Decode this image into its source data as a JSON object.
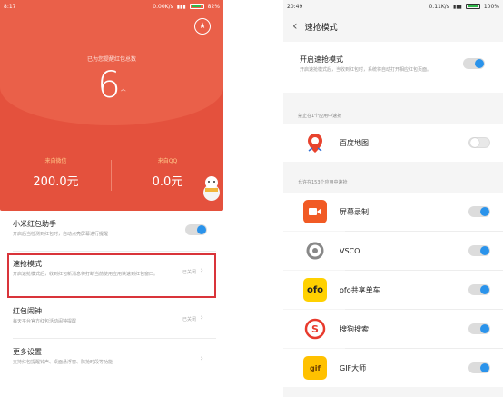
{
  "left": {
    "status": {
      "time": "8:17",
      "speed": "0.00K/s",
      "battery": "82%"
    },
    "remind_text": "已为您提醒红包总数",
    "count": "6",
    "count_unit": "个",
    "wechat": {
      "label": "来自微信",
      "amount": "200.0元"
    },
    "qq": {
      "label": "来自QQ",
      "amount": "0.0元"
    },
    "rows": [
      {
        "title": "小米红包助手",
        "desc": "开启后当检测到红包时，自动点亮屏幕进行提醒",
        "toggle": "on"
      },
      {
        "title": "速抢模式",
        "desc": "开启速抢模式后，收到红包新消息将打断当前使用应用快速到红包窗口。",
        "status": "已关闭"
      },
      {
        "title": "红包闹钟",
        "desc": "每天平台官方红包活动闹钟提醒",
        "status": "已关闭"
      },
      {
        "title": "更多设置",
        "desc": "支持红包提醒铃声、桌面悬浮窗、防抢时段等功能"
      }
    ]
  },
  "right": {
    "status": {
      "time": "20:49",
      "speed": "0.11K/s",
      "battery": "100%"
    },
    "title": "速抢模式",
    "main": {
      "title": "开启速抢模式",
      "desc": "开启速抢模式后，当收到红包时，系统将自动打开相应红包页面。",
      "toggle": "on"
    },
    "section_block": "禁止在1个应用中速抢",
    "blocked_app": {
      "name": "百度地图",
      "toggle": "off"
    },
    "section_allow": "允许在153个应用中速抢",
    "apps": [
      {
        "name": "屏幕录制",
        "icon": "screen-record-icon",
        "color": "#f15a24",
        "toggle": "on"
      },
      {
        "name": "VSCO",
        "icon": "vsco-icon",
        "color": "#ffffff",
        "toggle": "on"
      },
      {
        "name": "ofo共享单车",
        "icon": "ofo-icon",
        "color": "#ffd100",
        "toggle": "on"
      },
      {
        "name": "搜狗搜索",
        "icon": "sogou-icon",
        "color": "#ffffff",
        "toggle": "on"
      },
      {
        "name": "GIF大师",
        "icon": "gif-icon",
        "color": "#ffc100",
        "toggle": "on"
      }
    ]
  },
  "colors": {
    "red": "#e4513d",
    "toggle_on": "#2a93eb",
    "highlight": "#d9343a"
  }
}
